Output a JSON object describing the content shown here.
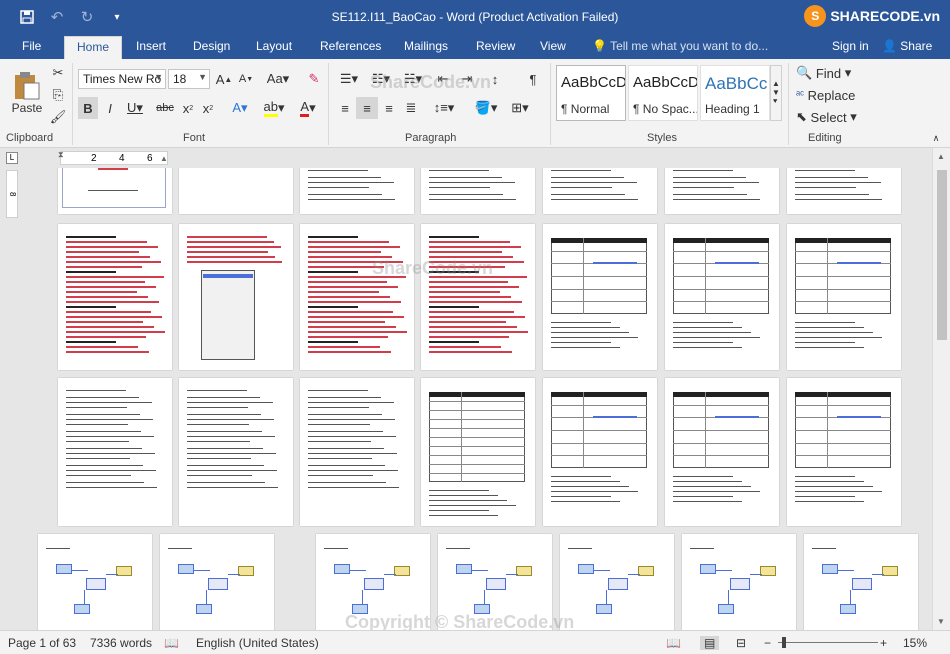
{
  "window": {
    "title": "SE112.I11_BaoCao - Word (Product Activation Failed)",
    "logo_text": "SHARECODE.vn",
    "qat": {
      "save_icon": "save-icon",
      "undo_icon": "undo-icon",
      "redo_icon": "redo-icon",
      "customize_icon": "customize-icon"
    }
  },
  "tabs": [
    "File",
    "Home",
    "Insert",
    "Design",
    "Layout",
    "References",
    "Mailings",
    "Review",
    "View"
  ],
  "active_tab": "Home",
  "tell_me": "Tell me what you want to do...",
  "sign_in": "Sign in",
  "share": "Share",
  "ribbon": {
    "clipboard": {
      "label": "Clipboard",
      "paste": "Paste"
    },
    "font": {
      "label": "Font",
      "name": "Times New Ro",
      "size": "18"
    },
    "paragraph": {
      "label": "Paragraph"
    },
    "styles": {
      "label": "Styles",
      "items": [
        {
          "sample": "AaBbCcDc",
          "name": "¶ Normal"
        },
        {
          "sample": "AaBbCcDc",
          "name": "¶ No Spac..."
        },
        {
          "sample": "AaBbCc",
          "name": "Heading 1"
        }
      ]
    },
    "editing": {
      "label": "Editing",
      "find": "Find",
      "replace": "Replace",
      "select": "Select"
    }
  },
  "ruler": {
    "marks": [
      "2",
      "4",
      "6"
    ]
  },
  "status": {
    "page": "Page 1 of 63",
    "words": "7336 words",
    "language": "English (United States)",
    "zoom": "15%"
  },
  "watermarks": [
    "ShareCode.vn",
    "ShareCode.vn",
    "Copyright © ShareCode.vn"
  ]
}
